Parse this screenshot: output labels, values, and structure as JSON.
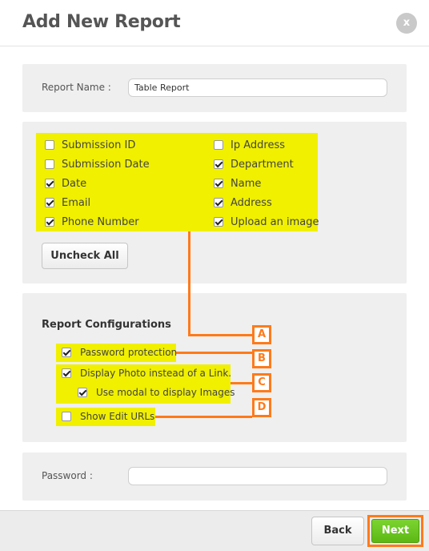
{
  "dialog": {
    "title": "Add New Report",
    "close_label": "x"
  },
  "report_name": {
    "label": "Report Name :",
    "value": "Table Report"
  },
  "fields": [
    {
      "label": "Submission ID",
      "checked": false
    },
    {
      "label": "Submission Date",
      "checked": false
    },
    {
      "label": "Date",
      "checked": true
    },
    {
      "label": "Email",
      "checked": true
    },
    {
      "label": "Phone Number",
      "checked": true
    },
    {
      "label": "Ip Address",
      "checked": false
    },
    {
      "label": "Department",
      "checked": true
    },
    {
      "label": "Name",
      "checked": true
    },
    {
      "label": "Address",
      "checked": true
    },
    {
      "label": "Upload an image",
      "checked": true
    }
  ],
  "uncheck_all_label": "Uncheck All",
  "config": {
    "title": "Report Configurations",
    "options": [
      {
        "label": "Password protection",
        "checked": true
      },
      {
        "label": "Display Photo instead of a Link.",
        "checked": true
      },
      {
        "label": "Use modal to display Images",
        "checked": true
      },
      {
        "label": "Show Edit URLs",
        "checked": false
      }
    ]
  },
  "password": {
    "label": "Password :",
    "value": ""
  },
  "annotations": [
    "A",
    "B",
    "C",
    "D"
  ],
  "footer": {
    "back_label": "Back",
    "next_label": "Next"
  },
  "colors": {
    "highlight": "#f0f000",
    "annotation": "#ff7a1a",
    "next_button": "#67c41f"
  }
}
